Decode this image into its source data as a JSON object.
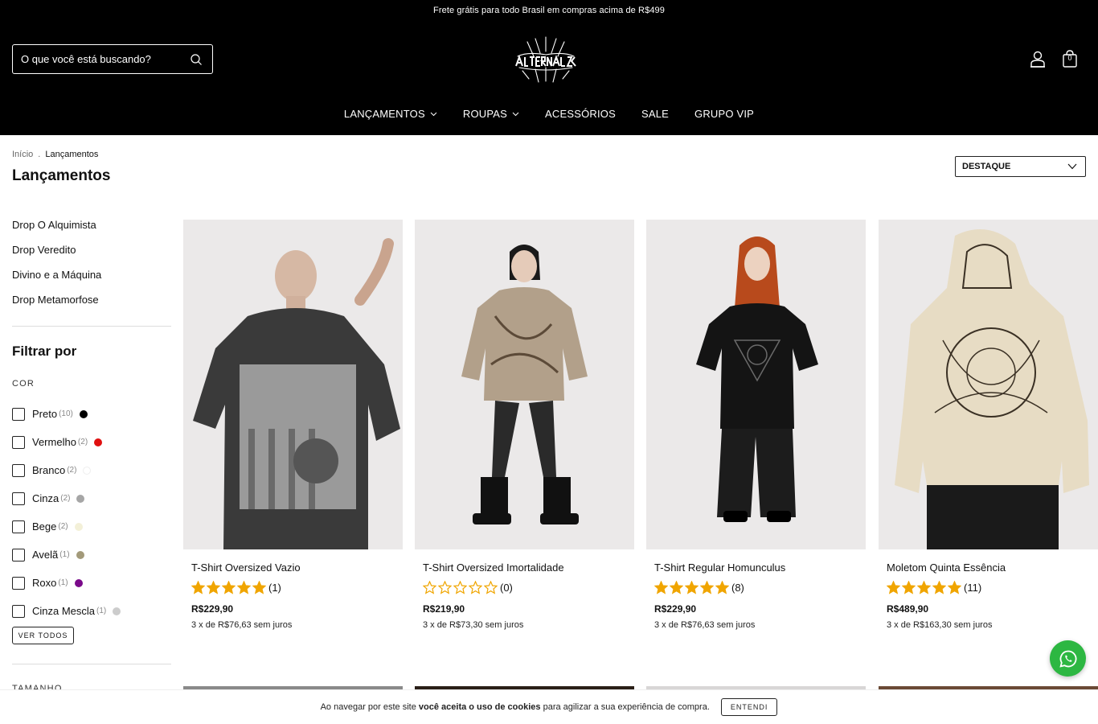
{
  "announcement": "Frete grátis para todo Brasil em compras acima de R$499",
  "search": {
    "placeholder": "O que você está buscando?"
  },
  "cart": {
    "count": "0"
  },
  "nav": [
    {
      "label": "LANÇAMENTOS",
      "has_dropdown": true
    },
    {
      "label": "ROUPAS",
      "has_dropdown": true
    },
    {
      "label": "ACESSÓRIOS",
      "has_dropdown": false
    },
    {
      "label": "SALE",
      "has_dropdown": false
    },
    {
      "label": "GRUPO VIP",
      "has_dropdown": false
    }
  ],
  "breadcrumb": {
    "home": "Início",
    "separator": ".",
    "current": "Lançamentos"
  },
  "page_title": "Lançamentos",
  "sort": {
    "selected": "DESTAQUE"
  },
  "sidebar": {
    "drops": [
      "Drop O Alquimista",
      "Drop Veredito",
      "Divino e a Máquina",
      "Drop Metamorfose"
    ],
    "filter_title": "Filtrar por",
    "color_label": "COR",
    "colors": [
      {
        "name": "Preto",
        "count": "(10)",
        "swatch": "#000000"
      },
      {
        "name": "Vermelho",
        "count": "(2)",
        "swatch": "#e01010"
      },
      {
        "name": "Branco",
        "count": "(2)",
        "swatch": "#ffffff"
      },
      {
        "name": "Cinza",
        "count": "(2)",
        "swatch": "#a6a6a6"
      },
      {
        "name": "Bege",
        "count": "(2)",
        "swatch": "#f3f0d8"
      },
      {
        "name": "Avelã",
        "count": "(1)",
        "swatch": "#a39a7a"
      },
      {
        "name": "Roxo",
        "count": "(1)",
        "swatch": "#7a0a8a"
      },
      {
        "name": "Cinza Mescla",
        "count": "(1)",
        "swatch": "#cccccc"
      }
    ],
    "see_all": "VER TODOS",
    "size_label": "TAMANHO"
  },
  "products": [
    {
      "name": "T-Shirt Oversized Vazio",
      "stars": 5,
      "reviews": "(1)",
      "price": "R$229,90",
      "installments": "3 x de R$76,63 sem juros"
    },
    {
      "name": "T-Shirt Oversized Imortalidade",
      "stars": 0,
      "reviews": "(0)",
      "price": "R$219,90",
      "installments": "3 x de R$73,30 sem juros"
    },
    {
      "name": "T-Shirt Regular Homunculus",
      "stars": 5,
      "reviews": "(8)",
      "price": "R$229,90",
      "installments": "3 x de R$76,63 sem juros"
    },
    {
      "name": "Moletom Quinta Essência",
      "stars": 5,
      "reviews": "(11)",
      "price": "R$489,90",
      "installments": "3 x de R$163,30 sem juros"
    }
  ],
  "cookie": {
    "text_before": "Ao navegar por este site",
    "text_bold": "você aceita o uso de cookies",
    "text_after": "para agilizar a sua experiência de compra.",
    "button": "ENTENDI"
  },
  "colors": {
    "header_bg": "#000000",
    "star": "#f0a500",
    "whatsapp": "#2db742"
  }
}
